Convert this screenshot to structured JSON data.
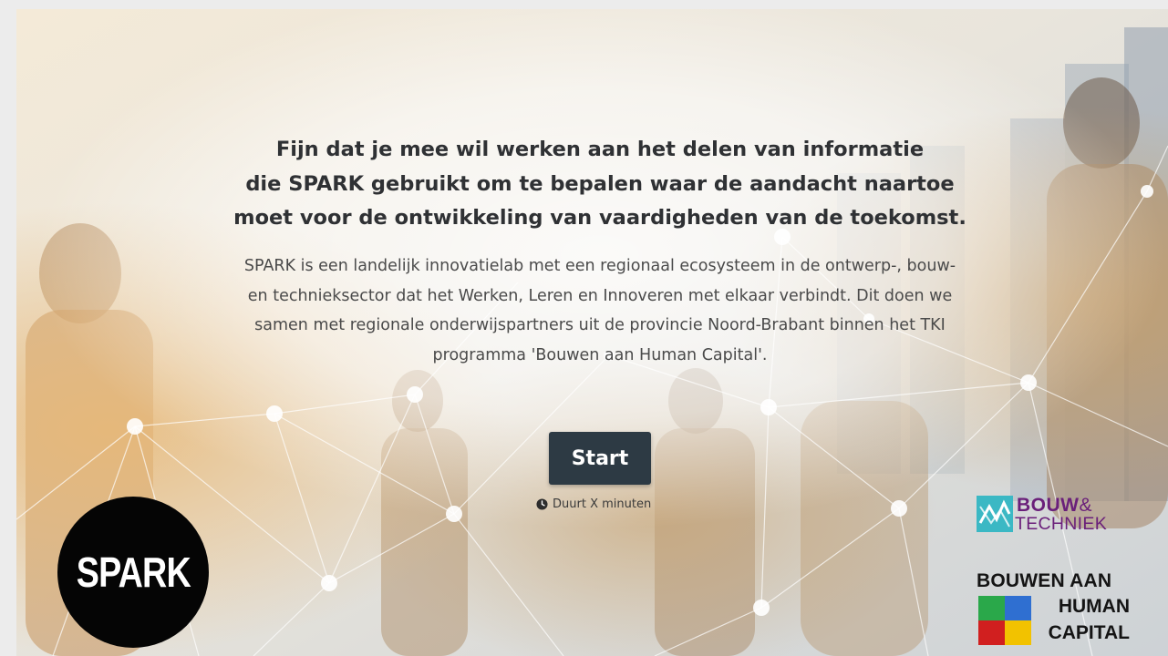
{
  "headline": {
    "line1": "Fijn dat je mee wil werken aan het delen van informatie",
    "line2": "die SPARK gebruikt om te bepalen waar de aandacht naartoe",
    "line3": "moet voor de ontwikkeling van vaardigheden van de toekomst."
  },
  "intro": "SPARK is een landelijk innovatielab met een regionaal ecosysteem in de ontwerp-, bouw- en technieksector dat het Werken, Leren en Innoveren met elkaar verbindt. Dit doen we samen met regionale onderwijspartners uit de provincie Noord-Brabant binnen het TKI programma 'Bouwen aan Human Capital'.",
  "start_button": {
    "label": "Start"
  },
  "duration": {
    "icon": "clock-icon",
    "text": "Duurt X minuten"
  },
  "logos": {
    "spark": "SPARK",
    "bouw_techniek": {
      "line1": "BOUW",
      "ampersand": "&",
      "line2": "TECHNIEK"
    },
    "bouwen_aan_human_capital": {
      "line1": "BOUWEN AAN",
      "line2": "HUMAN",
      "line3": "CAPITAL"
    }
  },
  "colors": {
    "start_button": "#2d3a44",
    "headline_text": "#2f3134",
    "body_text": "#4a4a4a",
    "spark_logo_bg": "#050505",
    "bouw_techniek_purple": "#6a1f7a",
    "bouw_techniek_teal": "#3bb8c4",
    "bahc_green": "#2aa84a",
    "bahc_blue": "#2f6fd1",
    "bahc_red": "#d11f1f",
    "bahc_yellow": "#f2c200"
  }
}
